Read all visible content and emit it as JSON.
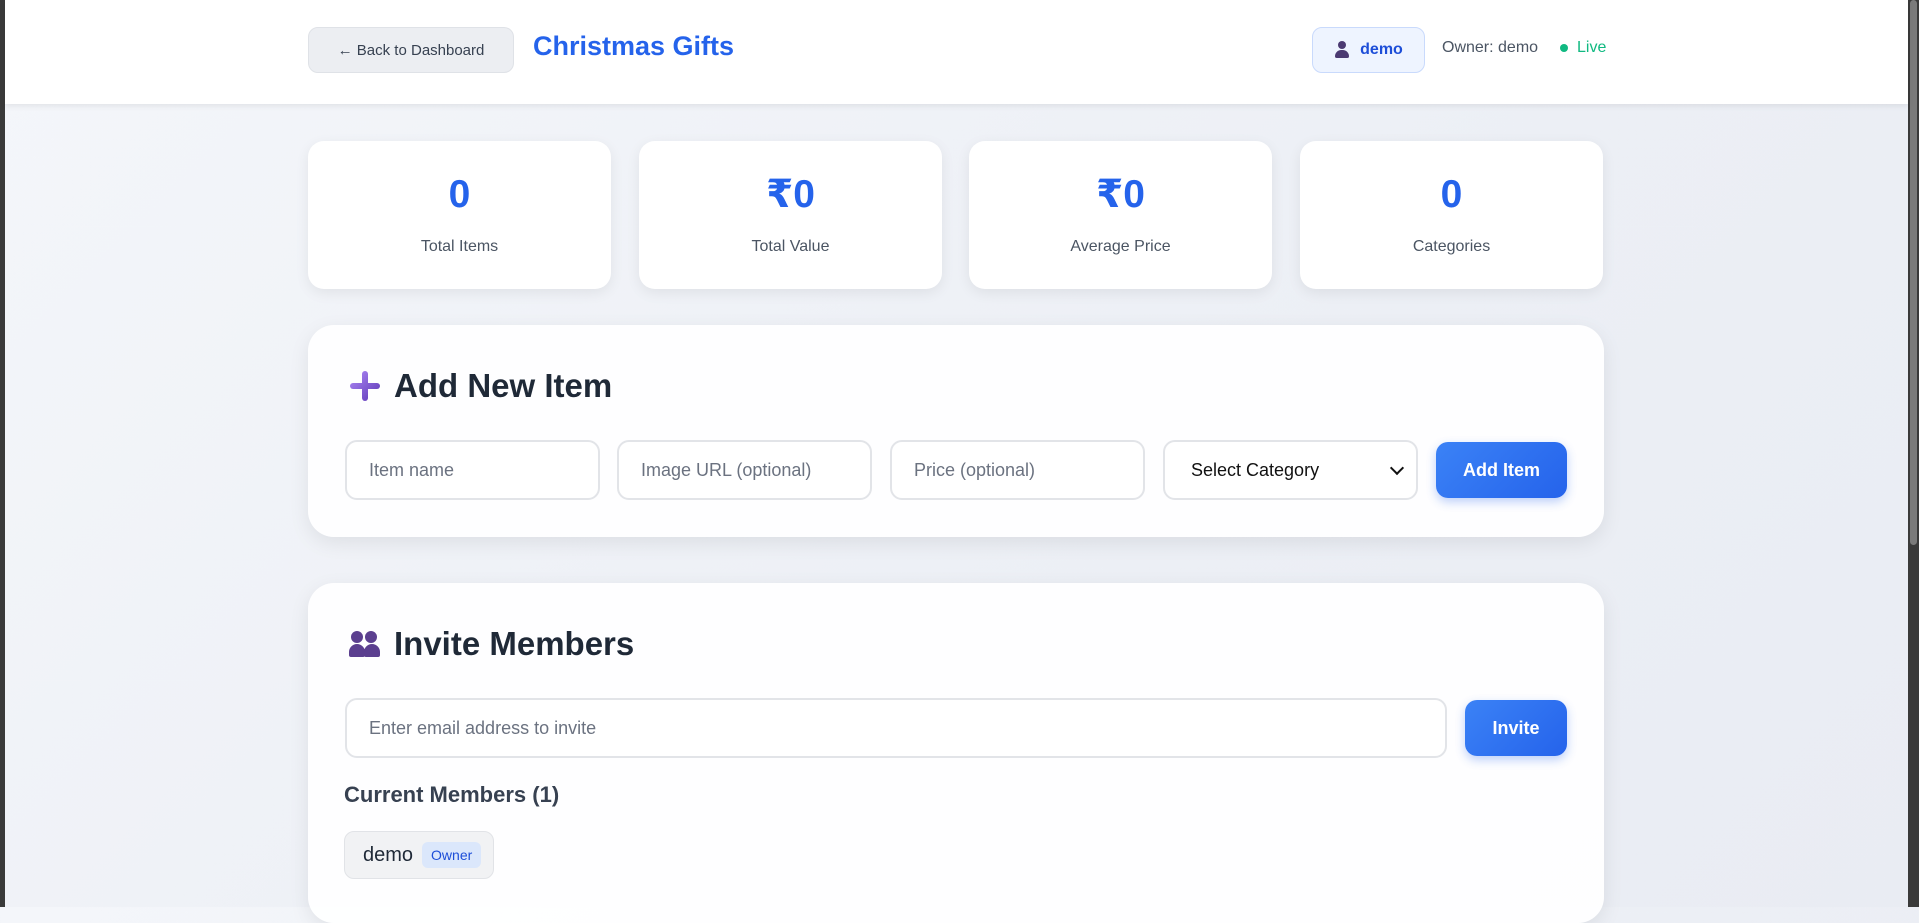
{
  "header": {
    "back_label": "← Back to Dashboard",
    "title": "Christmas Gifts",
    "user_name": "demo",
    "owner_text": "Owner: demo",
    "status": "Live"
  },
  "stats": [
    {
      "value": "0",
      "label": "Total Items"
    },
    {
      "value": "₹0",
      "label": "Total Value"
    },
    {
      "value": "₹0",
      "label": "Average Price"
    },
    {
      "value": "0",
      "label": "Categories"
    }
  ],
  "add_item": {
    "title": "Add New Item",
    "icon": "plus-icon",
    "name_placeholder": "Item name",
    "image_placeholder": "Image URL (optional)",
    "price_placeholder": "Price (optional)",
    "category_selected": "Select Category",
    "button_label": "Add Item"
  },
  "invite": {
    "title": "Invite Members",
    "icon": "people-icon",
    "email_placeholder": "Enter email address to invite",
    "button_label": "Invite",
    "members_heading": "Current Members (1)",
    "members": [
      {
        "name": "demo",
        "role": "Owner"
      }
    ]
  },
  "colors": {
    "accent": "#2563eb",
    "live": "#10b981"
  }
}
